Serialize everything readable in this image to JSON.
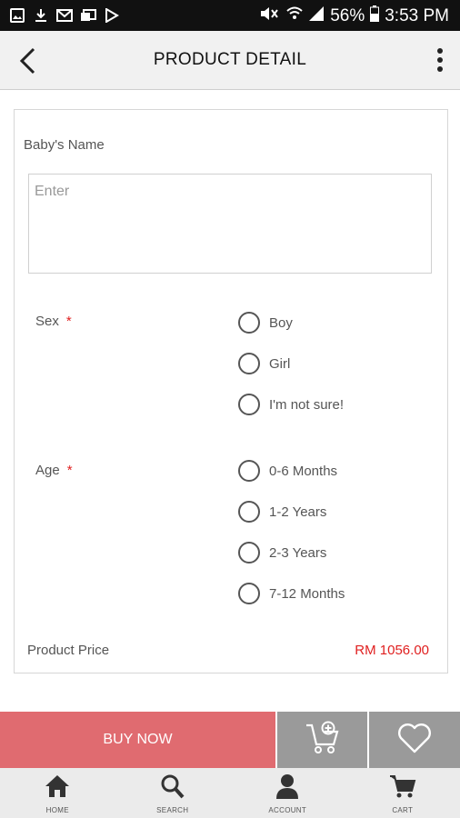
{
  "status_bar": {
    "left_icons": [
      "image-icon",
      "download-icon",
      "mail-icon",
      "messages-icon",
      "play-store-icon"
    ],
    "right_icons": [
      "mute-icon",
      "wifi-icon",
      "signal-icon",
      "battery-icon"
    ],
    "battery": "56%",
    "time": "3:53 PM"
  },
  "header": {
    "title": "PRODUCT DETAIL",
    "back_icon": "back-arrow-icon",
    "menu_icon": "more-vert-icon"
  },
  "form": {
    "baby_name_label": "Baby's Name",
    "baby_name_placeholder": "Enter",
    "sex": {
      "label": "Sex",
      "required": "*",
      "options": [
        "Boy",
        "Girl",
        "I'm not sure!"
      ]
    },
    "age": {
      "label": "Age",
      "required": "*",
      "options": [
        "0-6 Months",
        "1-2 Years",
        "2-3 Years",
        "7-12 Months"
      ]
    },
    "price_label": "Product Price",
    "price_value": "RM 1056.00"
  },
  "actions": {
    "buy_now": "BUY NOW",
    "add_to_cart_icon": "add-cart-icon",
    "wishlist_icon": "heart-icon"
  },
  "tabbar": {
    "items": [
      {
        "label": "HOME",
        "icon": "home-icon"
      },
      {
        "label": "SEARCH",
        "icon": "search-icon"
      },
      {
        "label": "ACCOUNT",
        "icon": "account-icon"
      },
      {
        "label": "CART",
        "icon": "cart-icon"
      }
    ]
  },
  "colors": {
    "buy_now_bg": "#e06b70",
    "price_red": "#e02020",
    "required_red": "#e02020",
    "action_gray": "#9a9a9a"
  }
}
